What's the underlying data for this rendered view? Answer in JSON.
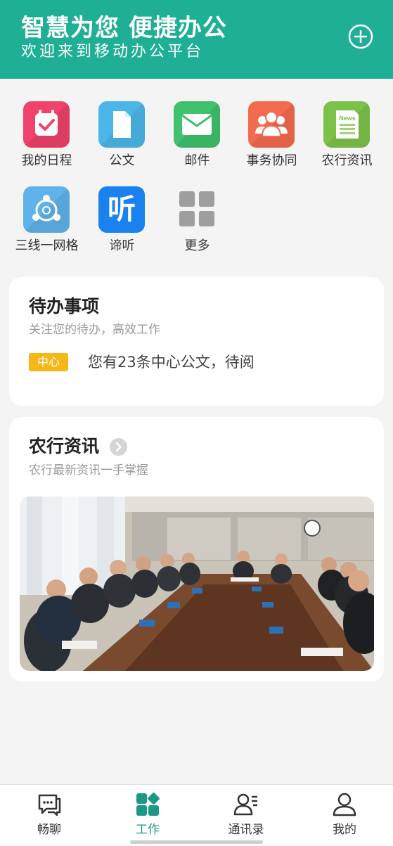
{
  "header": {
    "title": "智慧为您  便捷办公",
    "subtitle": "欢迎来到移动办公平台",
    "add_icon": "plus-circle-icon",
    "bg_color": "#1faf94"
  },
  "apps": [
    {
      "label": "我的日程",
      "icon": "calendar-check-icon",
      "color": "#f0436b"
    },
    {
      "label": "公文",
      "icon": "document-icon",
      "color": "#4cb6e8"
    },
    {
      "label": "邮件",
      "icon": "mail-icon",
      "color": "#3fc16d"
    },
    {
      "label": "事务协同",
      "icon": "users-icon",
      "color": "#f26b4f"
    },
    {
      "label": "农行资讯",
      "icon": "news-icon",
      "color": "#7cc24a"
    },
    {
      "label": "三线一网格",
      "icon": "network-icon",
      "color": "#5fb3ea"
    },
    {
      "label": "谛听",
      "icon": "listen-icon",
      "color": "#1a82ef",
      "glyph": "听"
    },
    {
      "label": "更多",
      "icon": "grid-more-icon",
      "color": "#9e9e9e"
    }
  ],
  "todo": {
    "title": "待办事项",
    "subtitle": "关注您的待办，高效工作",
    "badge": "中心",
    "text": "您有23条中心公文，待阅",
    "badge_color": "#f7b719"
  },
  "news": {
    "title": "农行资讯",
    "subtitle": "农行最新资讯一手掌握",
    "arrow_icon": "chevron-right-icon"
  },
  "news_tag": "News",
  "tabs": [
    {
      "label": "畅聊",
      "icon": "chat-icon",
      "active": false
    },
    {
      "label": "工作",
      "icon": "work-grid-icon",
      "active": true
    },
    {
      "label": "通讯录",
      "icon": "contacts-icon",
      "active": false
    },
    {
      "label": "我的",
      "icon": "profile-icon",
      "active": false
    }
  ],
  "accent_color": "#1a9a84"
}
